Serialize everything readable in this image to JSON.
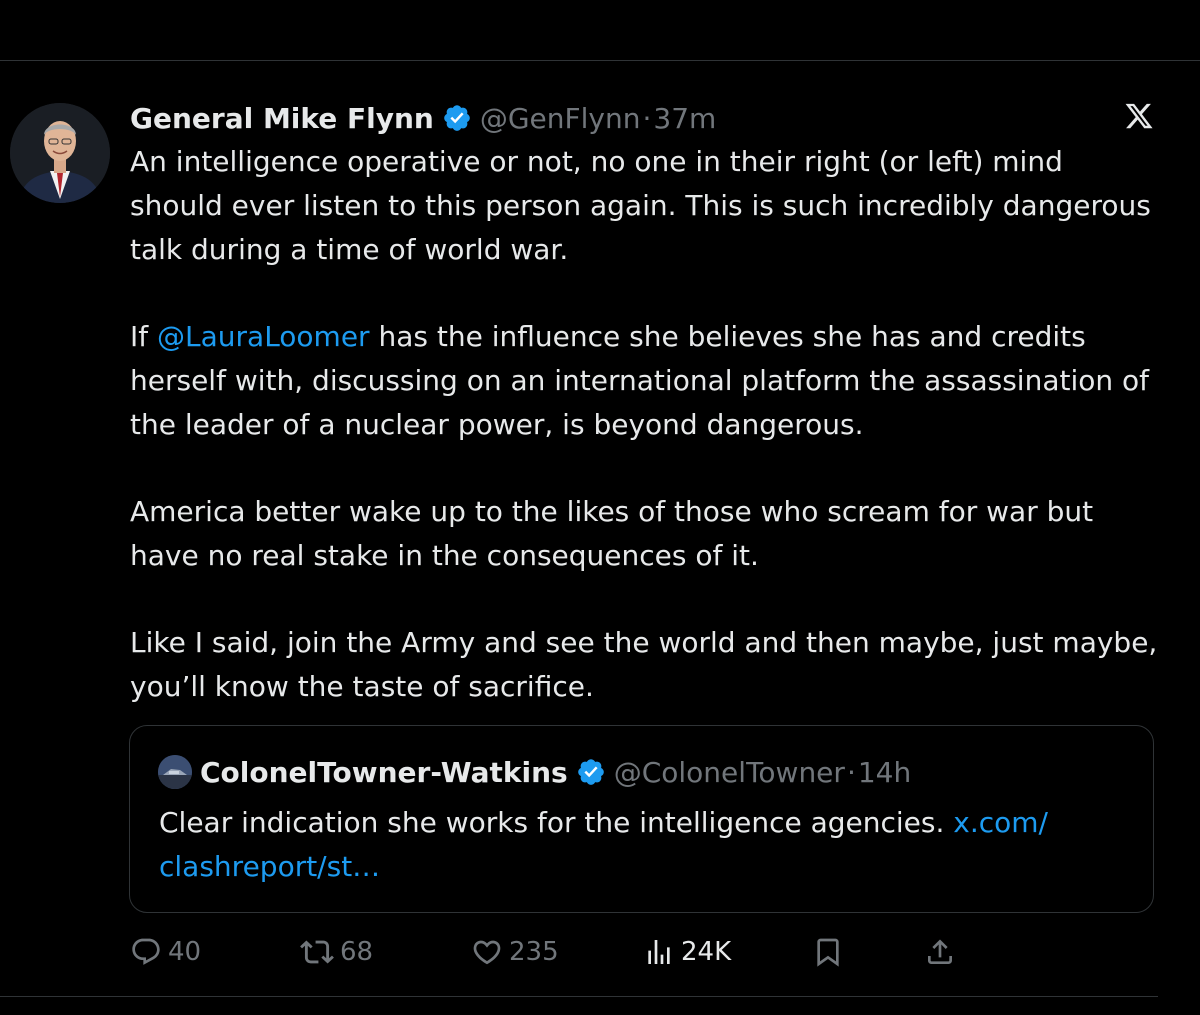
{
  "author": {
    "display_name": "General Mike Flynn",
    "handle": "@GenFlynn",
    "separator": "·",
    "time": "37m"
  },
  "body": {
    "p1": "An intelligence operative or not, no one in their right (or left) mind should ever listen to this person again. This is such incredibly dangerous talk during a time of world war.",
    "p2_prefix": "If ",
    "p2_mention": "@LauraLoomer",
    "p2_rest": " has the influence she believes she has and credits herself with, discussing on an international platform the assassination of the leader of a nuclear power, is beyond dangerous.",
    "p3": "America better wake up to the likes of those who scream for war but have no real stake in the consequences of it.",
    "p4": "Like I said, join the Army and see the world and then maybe, just maybe, you’ll know the taste of sacrifice."
  },
  "quote": {
    "display_name": "ColonelTowner-Watkins",
    "handle": "@ColonelTowner",
    "separator": "·",
    "time": "14h",
    "text": "Clear indication she works for the intelligence agencies. ",
    "link": "x.com/\nclashreport/st…"
  },
  "actions": {
    "replies": "40",
    "reposts": "68",
    "likes": "235",
    "views": "24K"
  },
  "colors": {
    "background": "#000000",
    "text": "#e7e9ea",
    "secondary": "#71767b",
    "accent": "#1d9bf0",
    "border": "#2f3336"
  },
  "icons": [
    "verified-badge-icon",
    "x-logo-icon",
    "reply-icon",
    "repost-icon",
    "like-icon",
    "views-icon",
    "bookmark-icon",
    "share-icon"
  ]
}
